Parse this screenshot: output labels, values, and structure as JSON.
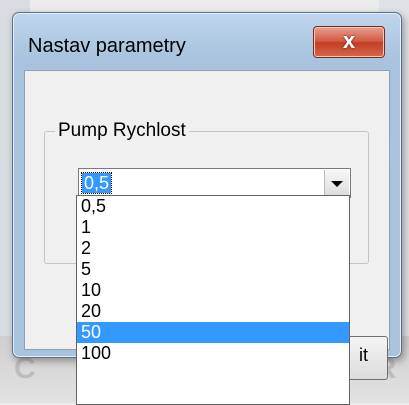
{
  "dialog": {
    "title": "Nastav parametry",
    "close_symbol": "x",
    "close_icon": "close-icon"
  },
  "group": {
    "label": "Pump Rychlost"
  },
  "combo": {
    "value": "0,5",
    "options": [
      "0,5",
      "1",
      "2",
      "5",
      "10",
      "20",
      "50",
      "100"
    ],
    "highlighted_option": "50",
    "dropdown_icon": "chevron-down-icon"
  },
  "partial_button": {
    "label_fragment": "it"
  },
  "background": {
    "left_text": "C",
    "right_text": "UR"
  },
  "colors": {
    "selection": "#3399ff",
    "titlebar": "#b5cde6",
    "close_button": "#c94a30"
  }
}
